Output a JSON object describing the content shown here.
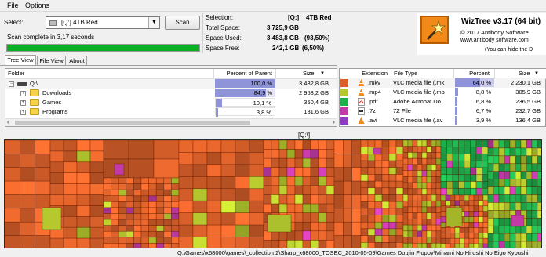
{
  "menu": {
    "file": "File",
    "options": "Options"
  },
  "select": {
    "label": "Select:",
    "value": "[Q:] 4TB Red",
    "dropdown_icon": "chevron-down-icon"
  },
  "scan": {
    "button": "Scan",
    "status": "Scan complete in 3,17 seconds",
    "progress": 1.0
  },
  "stats": {
    "selection_label": "Selection:",
    "selection_drive": "[Q:]",
    "selection_name": "4TB Red",
    "total_label": "Total Space:",
    "total_value": "3 725,9 GB",
    "used_label": "Space Used:",
    "used_value": "3 483,8 GB",
    "used_pct": "(93,50%)",
    "free_label": "Space Free:",
    "free_value": "242,1 GB",
    "free_pct": "(6,50%)"
  },
  "logo": {
    "title": "WizTree v3.17 (64 bit)",
    "copyright": "© 2017 Antibody Software",
    "url": "www.antibody software.com",
    "hide_text": "(You can hide the D"
  },
  "tabs": [
    "Tree View",
    "File View",
    "About"
  ],
  "tree": {
    "headers": {
      "folder": "Folder",
      "percent": "Percent of Parent",
      "size": "Size"
    },
    "rows": [
      {
        "name": "Q:\\",
        "percent": "100,0 %",
        "pct": 1.0,
        "size": "3 482,8 GB",
        "icon": "drive-icon",
        "toggle": "−"
      },
      {
        "name": "Downloads",
        "percent": "84,9 %",
        "pct": 0.849,
        "size": "2 958,2 GB",
        "icon": "folder-icon",
        "toggle": "+"
      },
      {
        "name": "Games",
        "percent": "10,1 %",
        "pct": 0.101,
        "size": "350,4 GB",
        "icon": "folder-icon",
        "toggle": "+"
      },
      {
        "name": "Programs",
        "percent": "3,8 %",
        "pct": 0.038,
        "size": "131,6 GB",
        "icon": "folder-icon",
        "toggle": "+"
      }
    ]
  },
  "extensions": {
    "headers": {
      "extension": "Extension",
      "filetype": "File Type",
      "percent": "Percent",
      "size": "Size"
    },
    "rows": [
      {
        "ext": ".mkv",
        "type": "VLC media file (.mk",
        "percent": "64,0 %",
        "pct": 0.64,
        "size": "2 230,1 GB",
        "color": "#d9602a",
        "icon": "vlc-icon"
      },
      {
        "ext": ".mp4",
        "type": "VLC media file (.mp",
        "percent": "8,8 %",
        "pct": 0.088,
        "size": "305,9 GB",
        "color": "#b5c92e",
        "icon": "vlc-icon"
      },
      {
        "ext": ".pdf",
        "type": "Adobe Acrobat Do",
        "percent": "6,8 %",
        "pct": 0.068,
        "size": "236,5 GB",
        "color": "#1fae4c",
        "icon": "pdf-icon"
      },
      {
        "ext": ".7z",
        "type": "7Z File",
        "percent": "6,7 %",
        "pct": 0.067,
        "size": "232,7 GB",
        "color": "#c23aa7",
        "icon": "archive-icon"
      },
      {
        "ext": ".avi",
        "type": "VLC media file (.av",
        "percent": "3,9 %",
        "pct": 0.039,
        "size": "136,4 GB",
        "color": "#8d3cc4",
        "icon": "vlc-icon"
      }
    ]
  },
  "treemap": {
    "label": "[Q:\\]",
    "colors": {
      "orange": "#d9602a",
      "lime": "#b5c92e",
      "green": "#1fae4c",
      "magenta": "#c23aa7"
    }
  },
  "statusbar": {
    "path": "Q:\\Games\\x68000\\games\\_collection 2\\Sharp_x68000_TOSEC_2010-05-09\\Games Doujin Floppy\\Minami No Hiroshi No Eigo Kyoushi"
  }
}
